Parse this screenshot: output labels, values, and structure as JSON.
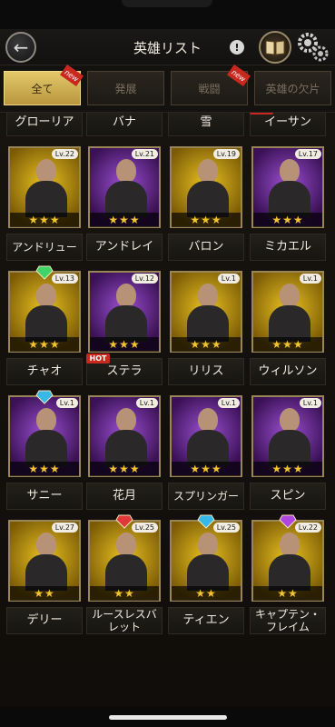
{
  "header": {
    "title": "英雄リスト",
    "info_label": "!"
  },
  "tabs": [
    {
      "label": "全て",
      "active": true,
      "badge": "new"
    },
    {
      "label": "発展",
      "active": false,
      "badge": ""
    },
    {
      "label": "戦闘",
      "active": false,
      "badge": "new"
    },
    {
      "label": "英雄の欠片",
      "active": false,
      "badge": ""
    }
  ],
  "heroes": [
    {
      "name": "グローリア",
      "level": "",
      "stars": "★★★★",
      "frame": "gold",
      "gem": "",
      "hot": false
    },
    {
      "name": "バナ",
      "level": "",
      "stars": "★★★★",
      "frame": "purple",
      "gem": "",
      "hot": false
    },
    {
      "name": "雪",
      "level": "",
      "stars": "★★★",
      "frame": "purple",
      "gem": "green",
      "hot": false
    },
    {
      "name": "イーサン",
      "level": "",
      "stars": "★★★",
      "frame": "purple",
      "gem": "",
      "hot": true
    },
    {
      "name": "アンドリュー",
      "level": "Lv.22",
      "stars": "★★★",
      "frame": "gold",
      "gem": "",
      "hot": false
    },
    {
      "name": "アンドレイ",
      "level": "Lv.21",
      "stars": "★★★",
      "frame": "purple",
      "gem": "",
      "hot": false
    },
    {
      "name": "バロン",
      "level": "Lv.19",
      "stars": "★★★",
      "frame": "gold",
      "gem": "",
      "hot": false
    },
    {
      "name": "ミカエル",
      "level": "Lv.17",
      "stars": "★★★",
      "frame": "purple",
      "gem": "",
      "hot": false
    },
    {
      "name": "チャオ",
      "level": "Lv.13",
      "stars": "★★★",
      "frame": "gold",
      "gem": "green",
      "hot": false
    },
    {
      "name": "ステラ",
      "level": "Lv.12",
      "stars": "★★★",
      "frame": "purple",
      "gem": "",
      "hot": true
    },
    {
      "name": "リリス",
      "level": "Lv.1",
      "stars": "★★★",
      "frame": "gold",
      "gem": "",
      "hot": false
    },
    {
      "name": "ウィルソン",
      "level": "Lv.1",
      "stars": "★★★",
      "frame": "gold",
      "gem": "",
      "hot": false
    },
    {
      "name": "サニー",
      "level": "Lv.1",
      "stars": "★★★",
      "frame": "purple",
      "gem": "blue",
      "hot": false
    },
    {
      "name": "花月",
      "level": "Lv.1",
      "stars": "★★★",
      "frame": "purple",
      "gem": "",
      "hot": false
    },
    {
      "name": "スプリンガー",
      "level": "Lv.1",
      "stars": "★★★",
      "frame": "purple",
      "gem": "",
      "hot": false
    },
    {
      "name": "スピン",
      "level": "Lv.1",
      "stars": "★★★",
      "frame": "purple",
      "gem": "",
      "hot": false
    },
    {
      "name": "デリー",
      "level": "Lv.27",
      "stars": "★★",
      "frame": "gold",
      "gem": "",
      "hot": false
    },
    {
      "name": "ルースレスバレット",
      "level": "Lv.25",
      "stars": "★★",
      "frame": "gold",
      "gem": "red",
      "hot": false
    },
    {
      "name": "ティエン",
      "level": "Lv.25",
      "stars": "★★",
      "frame": "gold",
      "gem": "blue",
      "hot": false
    },
    {
      "name": "キャプテン・フレイム",
      "level": "Lv.22",
      "stars": "★★",
      "frame": "gold",
      "gem": "purple",
      "hot": false
    }
  ],
  "hot_label": "HOT",
  "colors": {
    "gold_frame": "#e8c020",
    "purple_frame": "#9b4fd1",
    "star": "#f3c52d",
    "active_tab": "#e3c86a",
    "hot_badge": "#c8281e"
  },
  "icons": [
    "back-arrow-icon",
    "info-icon",
    "hero-book-icon",
    "settings-gear-icon",
    "new-ribbon-icon",
    "star-icon",
    "gem-icon",
    "hot-badge-icon"
  ]
}
